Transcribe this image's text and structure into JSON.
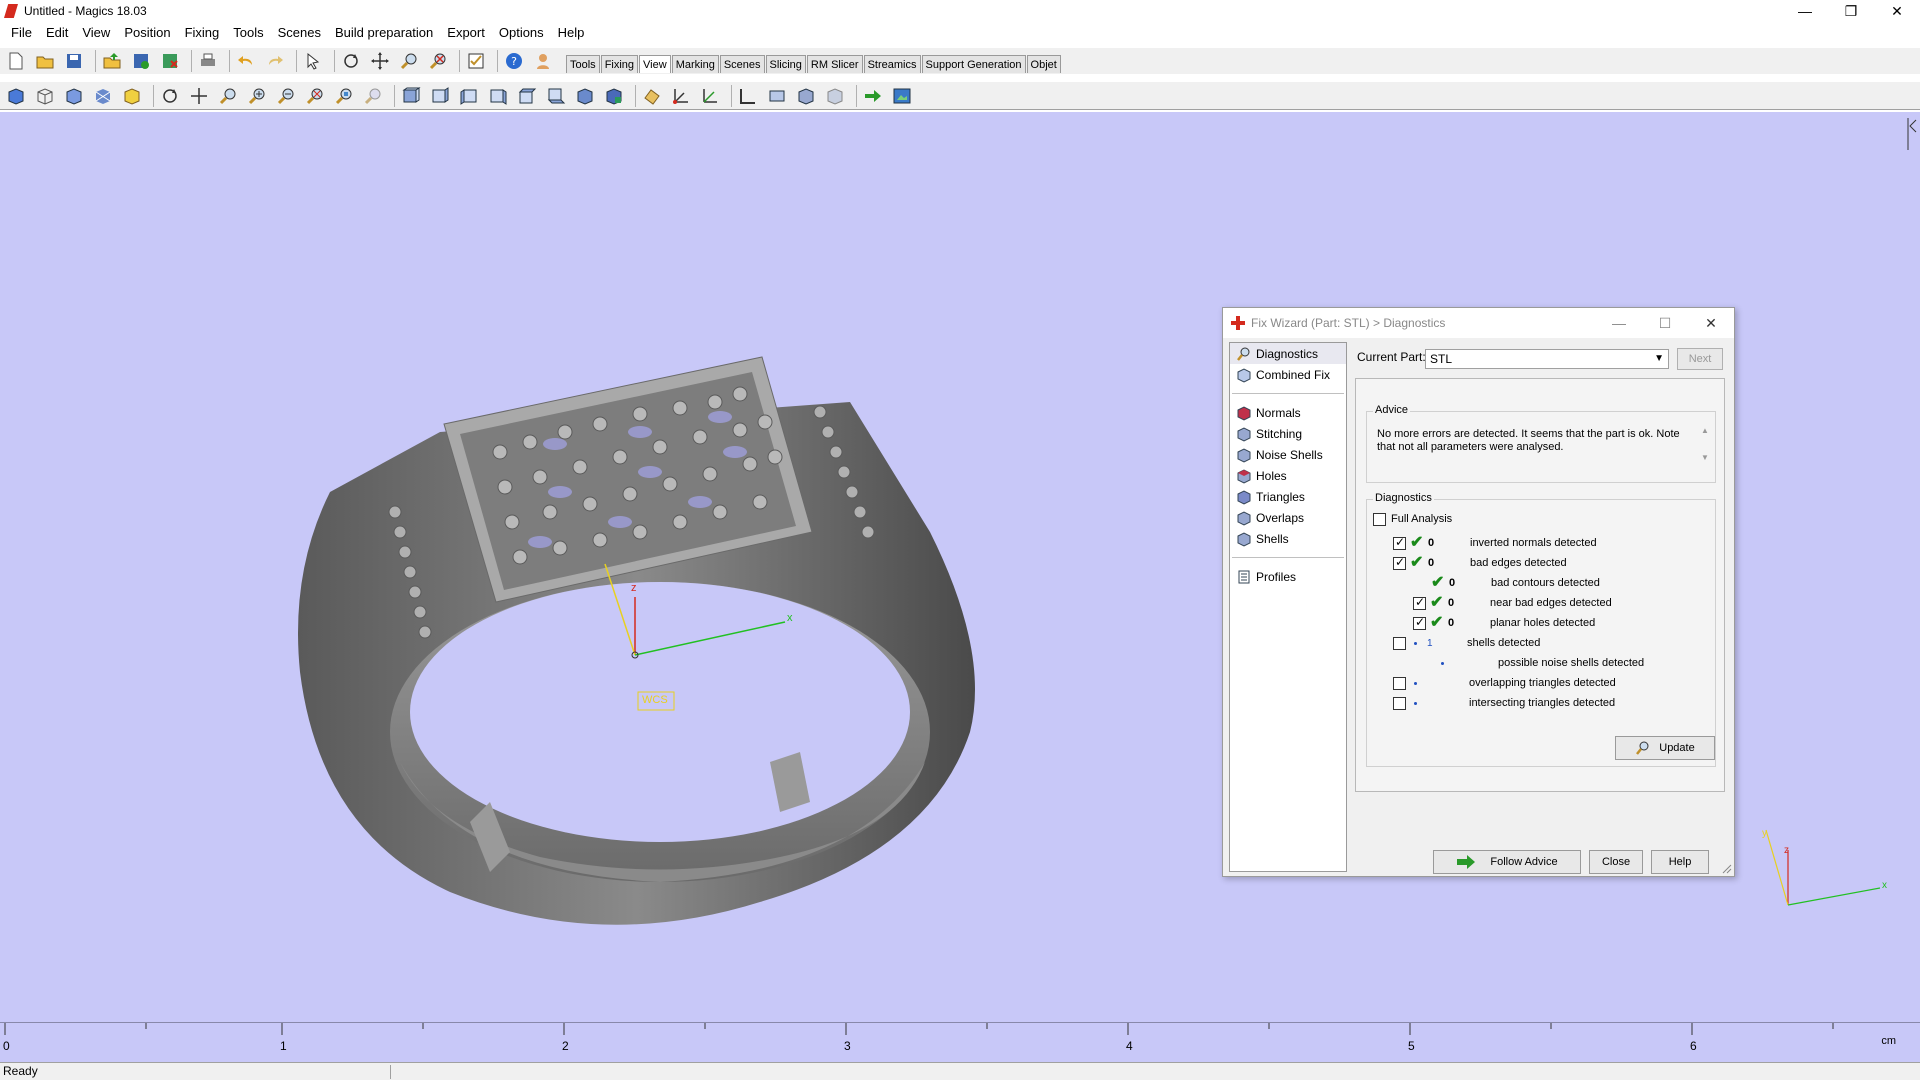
{
  "window": {
    "title": "Untitled - Magics 18.03",
    "minimize": "—",
    "restore": "❐",
    "close": "✕"
  },
  "menu": [
    "File",
    "Edit",
    "View",
    "Position",
    "Fixing",
    "Tools",
    "Scenes",
    "Build preparation",
    "Export",
    "Options",
    "Help"
  ],
  "toolbar_tabs": [
    "Tools",
    "Fixing",
    "View",
    "Marking",
    "Scenes",
    "Slicing",
    "RM Slicer",
    "Streamics",
    "Support Generation",
    "Objet"
  ],
  "active_tab": "View",
  "viewport": {
    "wcs_label": "WCS",
    "axis_x": "x",
    "axis_z": "z",
    "axis_y": "y",
    "background": "#c8c8f8"
  },
  "ruler": {
    "labels": [
      "0",
      "1",
      "2",
      "3",
      "4",
      "5",
      "6"
    ],
    "unit": "cm"
  },
  "status": {
    "text": "Ready"
  },
  "dialog": {
    "title": "Fix Wizard (Part: STL) > Diagnostics",
    "nav_top": [
      "Diagnostics",
      "Combined Fix"
    ],
    "nav_tools": [
      "Normals",
      "Stitching",
      "Noise Shells",
      "Holes",
      "Triangles",
      "Overlaps",
      "Shells"
    ],
    "nav_bottom": [
      "Profiles"
    ],
    "current_part_label": "Current Part:",
    "current_part_value": "STL",
    "next_label": "Next",
    "advice_title": "Advice",
    "advice_text": "No more errors are detected. It seems that the part is ok. Note that not all parameters were analysed.",
    "diagnostics_title": "Diagnostics",
    "full_analysis_label": "Full Analysis",
    "rows": [
      {
        "count": "0",
        "label": "inverted normals detected"
      },
      {
        "count": "0",
        "label": "bad edges detected"
      },
      {
        "count": "0",
        "label": "bad contours detected"
      },
      {
        "count": "0",
        "label": "near bad edges detected"
      },
      {
        "count": "0",
        "label": "planar holes detected"
      },
      {
        "count": "1",
        "label": "shells detected"
      },
      {
        "count": "",
        "label": "possible noise shells detected"
      },
      {
        "count": "",
        "label": "overlapping triangles detected"
      },
      {
        "count": "",
        "label": "intersecting triangles detected"
      }
    ],
    "update_label": "Update",
    "follow_advice_label": "Follow Advice",
    "close_label": "Close",
    "help_label": "Help"
  }
}
